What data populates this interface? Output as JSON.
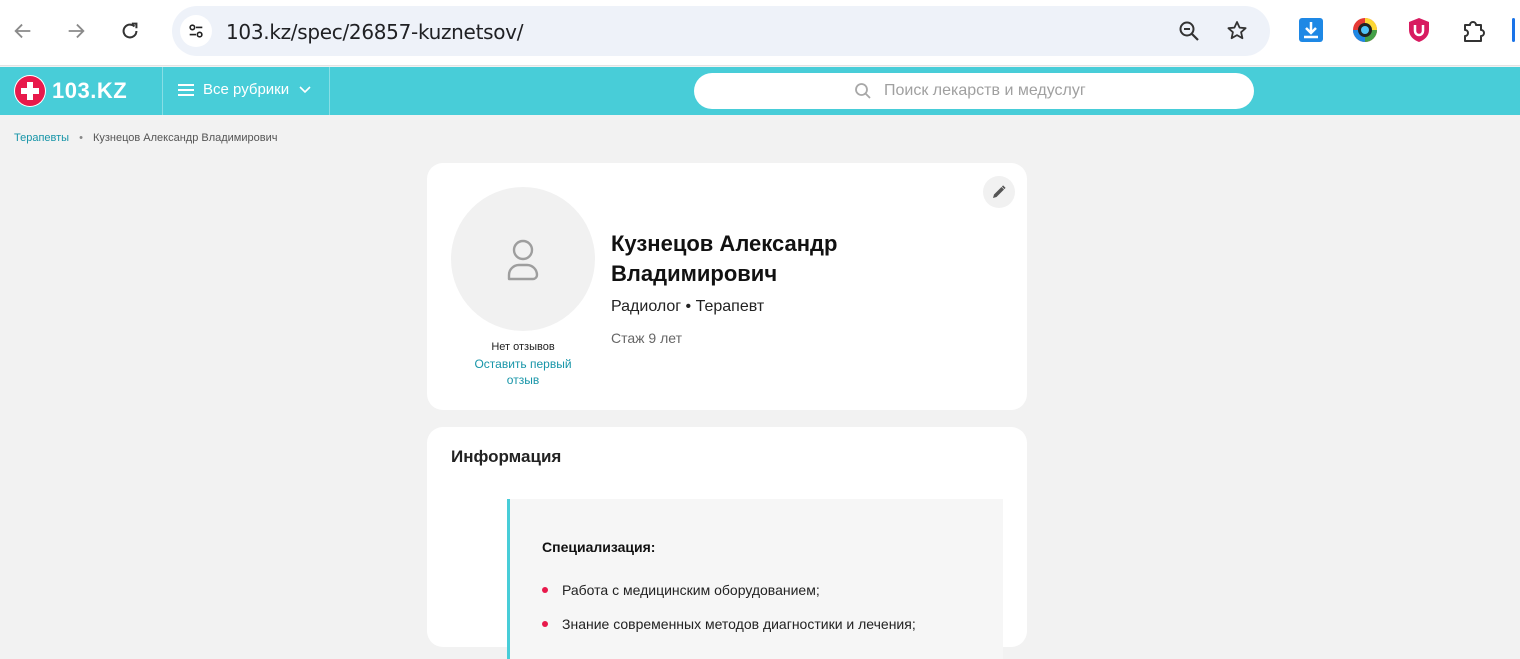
{
  "browser": {
    "url": "103.kz/spec/26857-kuznetsov/",
    "back_icon": "arrow-left-icon",
    "forward_icon": "arrow-right-icon",
    "reload_icon": "reload-icon",
    "zoom_icon": "zoom-out-icon",
    "bookmark_icon": "star-icon",
    "extensions": [
      "download-extension-icon",
      "camera-extension-icon",
      "shield-extension-icon",
      "puzzle-extensions-icon"
    ]
  },
  "header": {
    "logo_text": "103.KZ",
    "rubrics_label": "Все рубрики",
    "search_placeholder": "Поиск лекарств и медуслуг",
    "accent_color": "#48cdd8",
    "logo_cross_color": "#e8194b"
  },
  "breadcrumb": {
    "parent": "Терапевты",
    "separator": "•",
    "current": "Кузнецов Александр Владимирович"
  },
  "profile": {
    "name": "Кузнецов Александр Владимирович",
    "specialties": "Радиолог • Терапевт",
    "experience": "Стаж 9 лет",
    "reviews_status": "Нет отзывов",
    "review_link": "Оставить первый отзыв"
  },
  "info": {
    "title": "Информация",
    "spec_heading": "Специализация:",
    "items": [
      "Работа с медицинским оборудованием;",
      "Знание современных методов диагностики и лечения;"
    ]
  }
}
